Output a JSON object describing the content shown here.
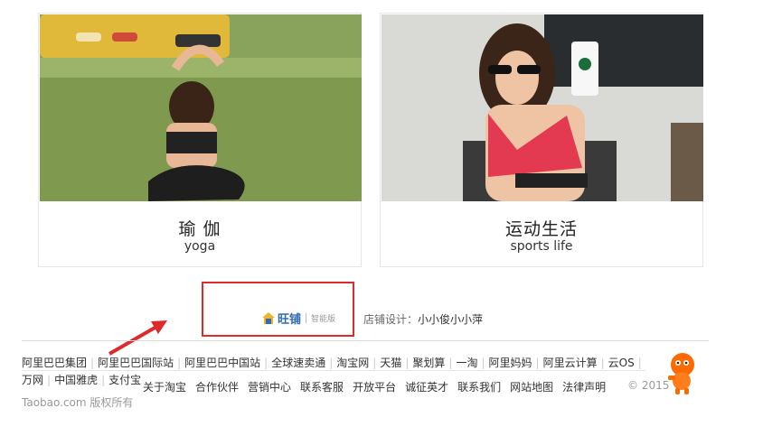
{
  "cards": [
    {
      "title": "瑜 伽",
      "subtitle": "yoga"
    },
    {
      "title": "运动生活",
      "subtitle": "sports life"
    }
  ],
  "shop_badge": {
    "brand": "旺铺",
    "edition": "智能版",
    "designer_label": "店铺设计：",
    "designer_name": "小小俊小小萍"
  },
  "footer": {
    "row1": [
      "阿里巴巴集团",
      "阿里巴巴国际站",
      "阿里巴巴中国站",
      "全球速卖通",
      "淘宝网",
      "天猫",
      "聚划算",
      "一淘",
      "阿里妈妈",
      "阿里云计算",
      "云OS"
    ],
    "row2": [
      "万网",
      "中国雅虎",
      "支付宝"
    ],
    "row3": [
      "关于淘宝",
      "合作伙伴",
      "营销中心",
      "联系客服",
      "开放平台",
      "诚征英才",
      "联系我们",
      "网站地图",
      "法律声明"
    ],
    "copyright": "Taobao.com 版权所有",
    "year": "© 2015"
  },
  "colors": {
    "highlight_box": "#e0292b",
    "arrow": "#e0292b",
    "brand": "#2e6bb4"
  }
}
